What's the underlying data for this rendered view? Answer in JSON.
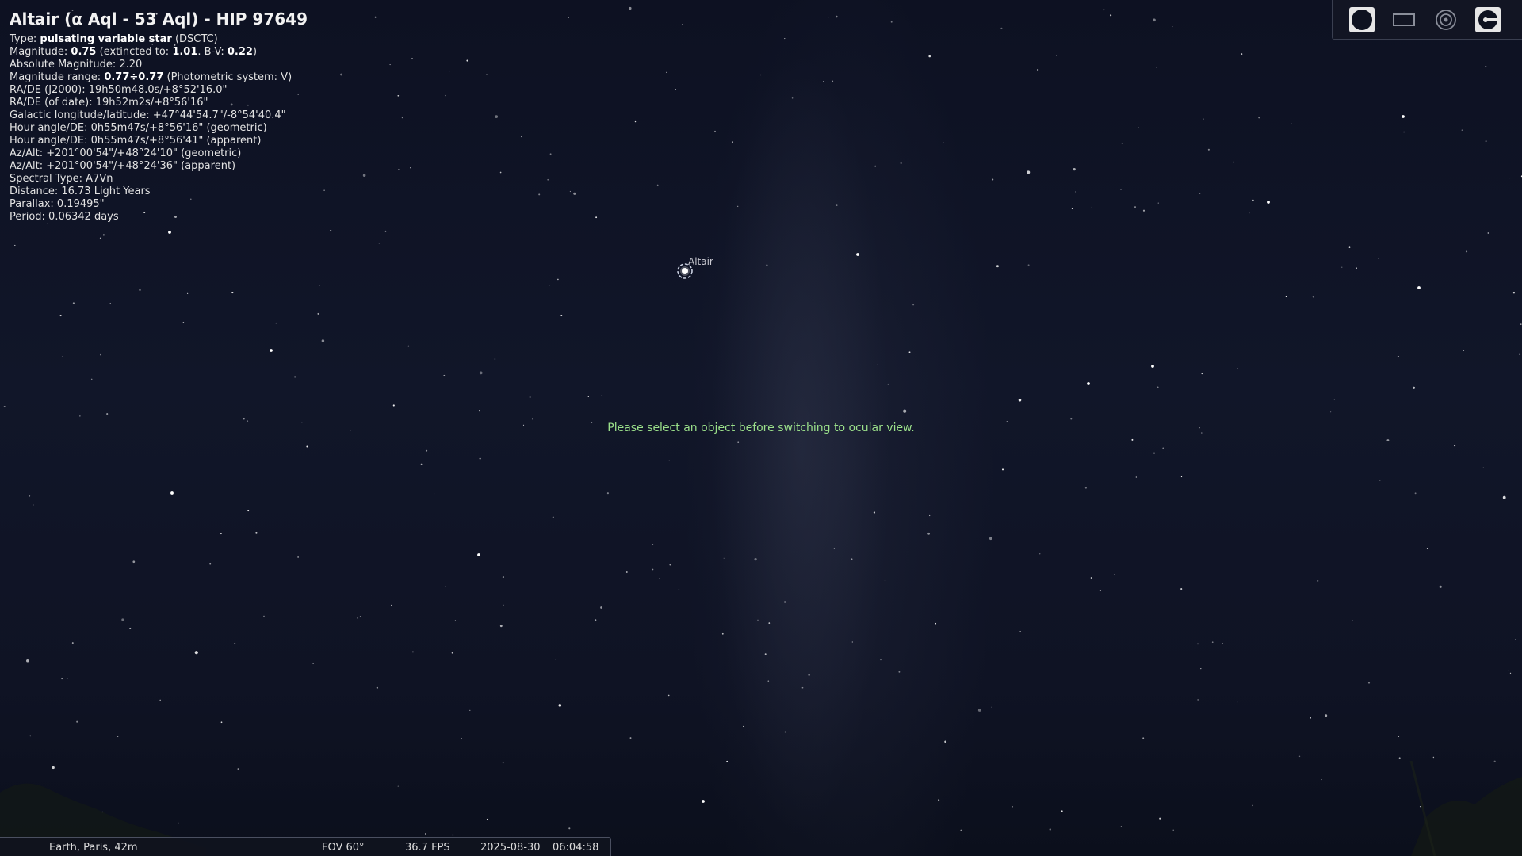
{
  "object": {
    "title": "Altair (α Aql - 53 Aql) - HIP 97649",
    "type": {
      "label": "Type:",
      "value": "pulsating variable star",
      "code": "(DSCTC)"
    },
    "magnitude": {
      "label": "Magnitude:",
      "value": "0.75",
      "extinct_label": "(extincted to:",
      "extinct_value": "1.01",
      "bv_label": ". B-V:",
      "bv_value": "0.22",
      "close": ")"
    },
    "absolute_magnitude": "Absolute Magnitude: 2.20",
    "magnitude_range": {
      "label": "Magnitude range:",
      "value": "0.77÷0.77",
      "system": "(Photometric system: V)"
    },
    "lines": [
      "RA/DE (J2000): 19h50m48.0s/+8°52'16.0\"",
      "RA/DE (of date): 19h52m2s/+8°56'16\"",
      "Galactic longitude/latitude: +47°44'54.7\"/-8°54'40.4\"",
      "Hour angle/DE: 0h55m47s/+8°56'16\" (geometric)",
      "Hour angle/DE: 0h55m47s/+8°56'41\" (apparent)",
      "Az/Alt: +201°00'54\"/+48°24'10\" (geometric)",
      "Az/Alt: +201°00'54\"/+48°24'36\" (apparent)",
      "Spectral Type: A7Vn",
      "Distance: 16.73 Light Years",
      "Parallax: 0.19495\"",
      "Period: 0.06342 days"
    ]
  },
  "sky": {
    "selected_star_label": "Altair",
    "message": "Please select an object before switching to ocular view."
  },
  "toolbar": {
    "icons": [
      "ocular-circle-icon",
      "sensor-frame-icon",
      "telrad-icon",
      "configuration-icon"
    ]
  },
  "status": {
    "location": "Earth, Paris, 42m",
    "fov": "FOV 60°",
    "fps": "36.7 FPS",
    "date": "2025-08-30",
    "time": "06:04:58"
  },
  "colors": {
    "message": "#9be08a",
    "sky_background": "#0c1020",
    "text": "#e6e6e6"
  }
}
